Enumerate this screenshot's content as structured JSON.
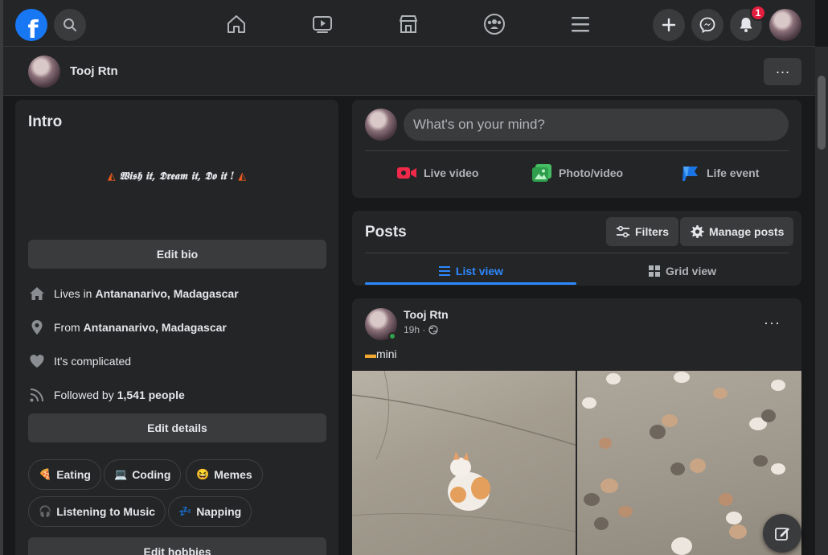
{
  "topnav": {
    "logo": "f",
    "notification_count": "1",
    "icons": [
      "facebook-logo-icon",
      "search-icon",
      "home-icon",
      "watch-icon",
      "marketplace-icon",
      "groups-icon",
      "menu-icon",
      "plus-icon",
      "messenger-icon",
      "bell-icon"
    ]
  },
  "profile": {
    "name": "Tooj Rtn",
    "more_label": "···"
  },
  "intro": {
    "title": "Intro",
    "bio": "𝖂𝖎𝖘𝖍 𝖎𝖙, 𝕯𝖗𝖊𝖆𝖒 𝖎𝖙, 𝕯𝖔 𝖎𝖙 !",
    "edit_bio": "Edit bio",
    "details": [
      {
        "icon": "home-icon",
        "prefix": "Lives in",
        "value": "Antananarivo, Madagascar"
      },
      {
        "icon": "location-pin-icon",
        "prefix": "From",
        "value": "Antananarivo, Madagascar"
      },
      {
        "icon": "heart-icon",
        "prefix": "It's complicated",
        "value": ""
      },
      {
        "icon": "rss-icon",
        "prefix": "Followed by",
        "value": "1,541 people"
      }
    ],
    "edit_details": "Edit details",
    "hobbies": [
      {
        "icon": "🍕",
        "label": "Eating"
      },
      {
        "icon": "💻",
        "label": "Coding"
      },
      {
        "icon": "😆",
        "label": "Memes"
      },
      {
        "icon": "🎧",
        "label": "Listening to Music"
      },
      {
        "icon": "💤",
        "label": "Napping"
      }
    ],
    "edit_hobbies": "Edit hobbies"
  },
  "composer": {
    "placeholder": "What's on your mind?",
    "actions": [
      {
        "label": "Live video",
        "color": "#f02849"
      },
      {
        "label": "Photo/video",
        "color": "#45bd62"
      },
      {
        "label": "Life event",
        "color": "#1b74e4"
      }
    ]
  },
  "posts": {
    "title": "Posts",
    "filters": "Filters",
    "manage": "Manage posts",
    "tabs": [
      {
        "label": "List view",
        "active": true
      },
      {
        "label": "Grid view",
        "active": false
      }
    ]
  },
  "post": {
    "author": "Tooj Rtn",
    "time": "19h ·",
    "text": "mini",
    "dots": "···"
  },
  "colors": {
    "accent": "#2d88ff",
    "brand": "#1877f2",
    "badge": "#e41e3f",
    "online": "#31a24c"
  }
}
